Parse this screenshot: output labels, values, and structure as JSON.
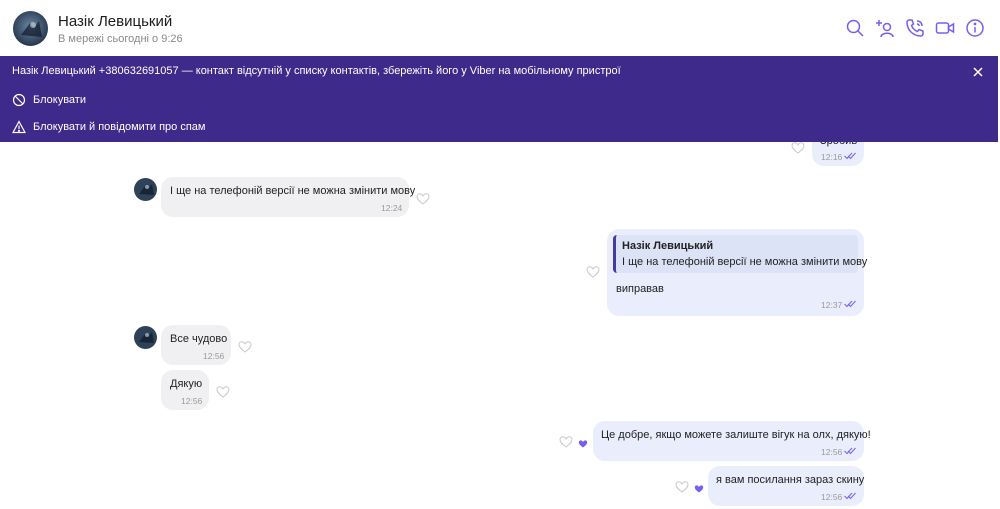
{
  "header": {
    "contact_name": "Назік Левицький",
    "status": "В мережі сьогодні о 9:26",
    "icons": [
      "search-icon",
      "add-participant-icon",
      "audio-call-icon",
      "video-call-icon",
      "info-icon"
    ]
  },
  "banner": {
    "notice": "Назік Левицький +380632691057 — контакт відсутній у списку контактів, збережіть його у Viber на мобільному пристрої",
    "block_label": "Блокувати",
    "block_spam_label": "Блокувати й повідомити про спам"
  },
  "colors": {
    "banner_bg": "#3d2a8a",
    "accent": "#7360f2",
    "incoming_bubble": "#f0f0f2",
    "outgoing_bubble": "#eaedfb"
  },
  "messages": [
    {
      "direction": "out",
      "text": "Зробив",
      "time": "12:16",
      "partially_hidden": true
    },
    {
      "direction": "in",
      "text": "І ще на телефоній версії не можна змінити мову",
      "time": "12:24"
    },
    {
      "direction": "out",
      "quote_author": "Назік Левицький",
      "quote_text": "І ще на телефоній версії не можна змінити мову",
      "text": "виправав",
      "time": "12:37"
    },
    {
      "direction": "in",
      "text": "Все чудово",
      "time": "12:56"
    },
    {
      "direction": "in",
      "text": "Дякую",
      "time": "12:56"
    },
    {
      "direction": "out",
      "text": "Це добре, якщо можете залиште вігук на олх, дякую!",
      "time": "12:56",
      "liked": true
    },
    {
      "direction": "out",
      "text": "я вам посилання зараз скину",
      "time": "12:56",
      "liked": true
    }
  ]
}
